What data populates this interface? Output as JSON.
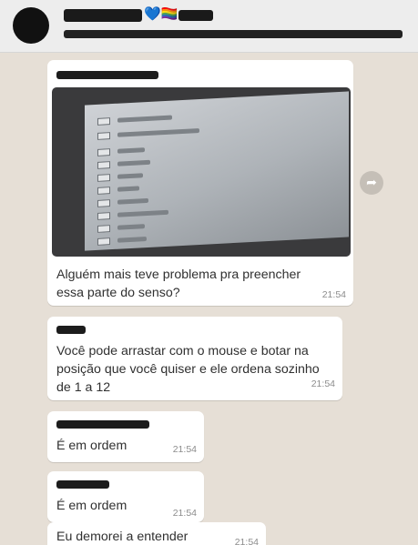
{
  "header": {
    "avatar_icon": "group-avatar",
    "title_emoji": "💙🏳️‍🌈"
  },
  "messages": [
    {
      "text": "Alguém mais teve problema pra preencher essa parte do senso?",
      "time": "21:54"
    },
    {
      "text": "Você pode arrastar com o mouse e botar na posição que você quiser e ele ordena sozinho de 1 a 12",
      "time": "21:54"
    },
    {
      "text": "É em ordem",
      "time": "21:54"
    },
    {
      "text": "É em ordem",
      "time": "21:54"
    },
    {
      "text": "Eu demorei a entender",
      "time": "21:54"
    }
  ],
  "forward_icon": "forward-arrow-icon"
}
